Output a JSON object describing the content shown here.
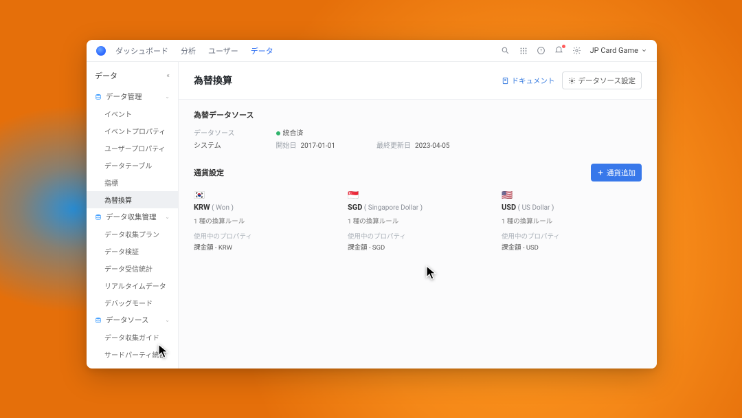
{
  "nav": {
    "tabs": [
      "ダッシュボード",
      "分析",
      "ユーザー",
      "データ"
    ],
    "active_index": 3
  },
  "team": {
    "name": "JP Card Game"
  },
  "sidebar": {
    "title": "データ",
    "groups": [
      {
        "label": "データ管理",
        "icon_color": "#4aa3ff",
        "items": [
          "イベント",
          "イベントプロパティ",
          "ユーザープロパティ",
          "データテーブル",
          "指標",
          "為替換算"
        ],
        "selected_index": 5
      },
      {
        "label": "データ収集管理",
        "icon_color": "#4aa3ff",
        "items": [
          "データ収集プラン",
          "データ検証",
          "データ受信統計",
          "リアルタイムデータ",
          "デバッグモード"
        ],
        "selected_index": -1
      },
      {
        "label": "データソース",
        "icon_color": "#4aa3ff",
        "items": [
          "データ収集ガイド",
          "サードパーティ統合"
        ],
        "selected_index": -1
      }
    ]
  },
  "page": {
    "title": "為替換算",
    "doc_button": "ドキュメント",
    "ds_button": "データソース設定"
  },
  "source": {
    "title": "為替データソース",
    "ds_label": "データソース",
    "ds_value": "システム",
    "status_label": "統合済",
    "start_label": "開始日",
    "start_value": "2017-01-01",
    "updated_label": "最終更新日",
    "updated_value": "2023-04-05"
  },
  "settings": {
    "title": "通貨設定",
    "add_button": "通貨追加",
    "rule_suffix": "種の換算ルール",
    "prop_label": "使用中のプロパティ",
    "currencies": [
      {
        "flag": "🇰🇷",
        "code": "KRW",
        "name": "( Won )",
        "rules": 1,
        "property": "課金額 - KRW"
      },
      {
        "flag": "🇸🇬",
        "code": "SGD",
        "name": "( Singapore Dollar )",
        "rules": 1,
        "property": "課金額 - SGD"
      },
      {
        "flag": "🇺🇸",
        "code": "USD",
        "name": "( US Dollar )",
        "rules": 1,
        "property": "課金額 - USD"
      }
    ]
  }
}
